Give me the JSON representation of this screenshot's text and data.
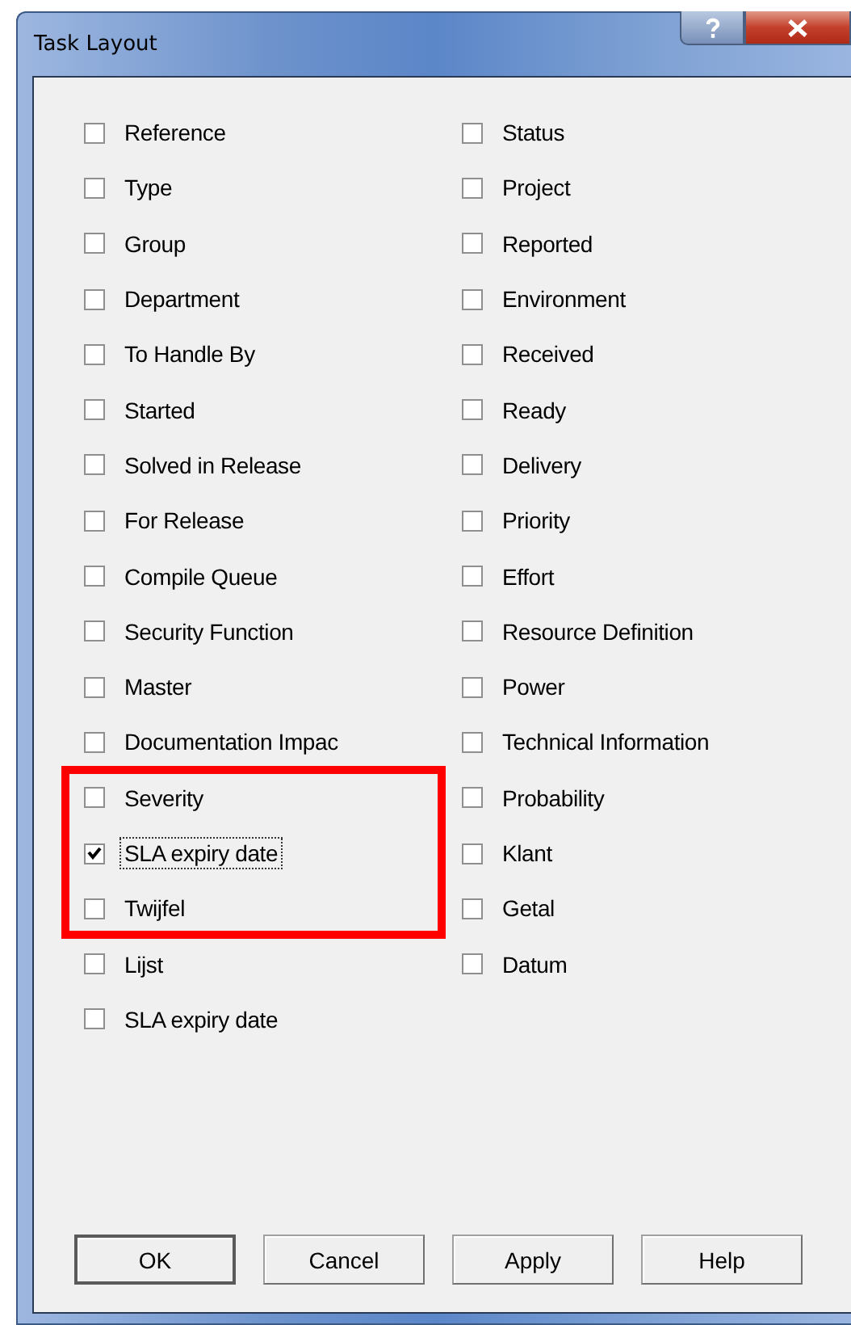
{
  "window": {
    "title": "Task Layout"
  },
  "columns": [
    [
      {
        "label": "Reference",
        "checked": false,
        "focused": false
      },
      {
        "label": "Type",
        "checked": false,
        "focused": false
      },
      {
        "label": "Group",
        "checked": false,
        "focused": false
      },
      {
        "label": "Department",
        "checked": false,
        "focused": false
      },
      {
        "label": "To Handle By",
        "checked": false,
        "focused": false
      },
      {
        "label": "Started",
        "checked": false,
        "focused": false
      },
      {
        "label": "Solved in Release",
        "checked": false,
        "focused": false
      },
      {
        "label": "For Release",
        "checked": false,
        "focused": false
      },
      {
        "label": "Compile Queue",
        "checked": false,
        "focused": false
      },
      {
        "label": "Security Function",
        "checked": false,
        "focused": false
      },
      {
        "label": "Master",
        "checked": false,
        "focused": false
      },
      {
        "label": "Documentation Impac",
        "checked": false,
        "focused": false
      },
      {
        "label": "Severity",
        "checked": false,
        "focused": false
      },
      {
        "label": "SLA expiry date",
        "checked": true,
        "focused": true
      },
      {
        "label": "Twijfel",
        "checked": false,
        "focused": false
      },
      {
        "label": "Lijst",
        "checked": false,
        "focused": false
      },
      {
        "label": "SLA expiry date",
        "checked": false,
        "focused": false
      }
    ],
    [
      {
        "label": "Status",
        "checked": false,
        "focused": false
      },
      {
        "label": "Project",
        "checked": false,
        "focused": false
      },
      {
        "label": "Reported",
        "checked": false,
        "focused": false
      },
      {
        "label": "Environment",
        "checked": false,
        "focused": false
      },
      {
        "label": "Received",
        "checked": false,
        "focused": false
      },
      {
        "label": "Ready",
        "checked": false,
        "focused": false
      },
      {
        "label": "Delivery",
        "checked": false,
        "focused": false
      },
      {
        "label": "Priority",
        "checked": false,
        "focused": false
      },
      {
        "label": "Effort",
        "checked": false,
        "focused": false
      },
      {
        "label": "Resource Definition",
        "checked": false,
        "focused": false
      },
      {
        "label": "Power",
        "checked": false,
        "focused": false
      },
      {
        "label": "Technical Information",
        "checked": false,
        "focused": false
      },
      {
        "label": "Probability",
        "checked": false,
        "focused": false
      },
      {
        "label": "Klant",
        "checked": false,
        "focused": false
      },
      {
        "label": "Getal",
        "checked": false,
        "focused": false
      },
      {
        "label": "Datum",
        "checked": false,
        "focused": false
      }
    ]
  ],
  "buttons": [
    {
      "label": "OK",
      "default": true
    },
    {
      "label": "Cancel",
      "default": false
    },
    {
      "label": "Apply",
      "default": false
    },
    {
      "label": "Help",
      "default": false
    }
  ],
  "highlight": {
    "shown": true
  }
}
